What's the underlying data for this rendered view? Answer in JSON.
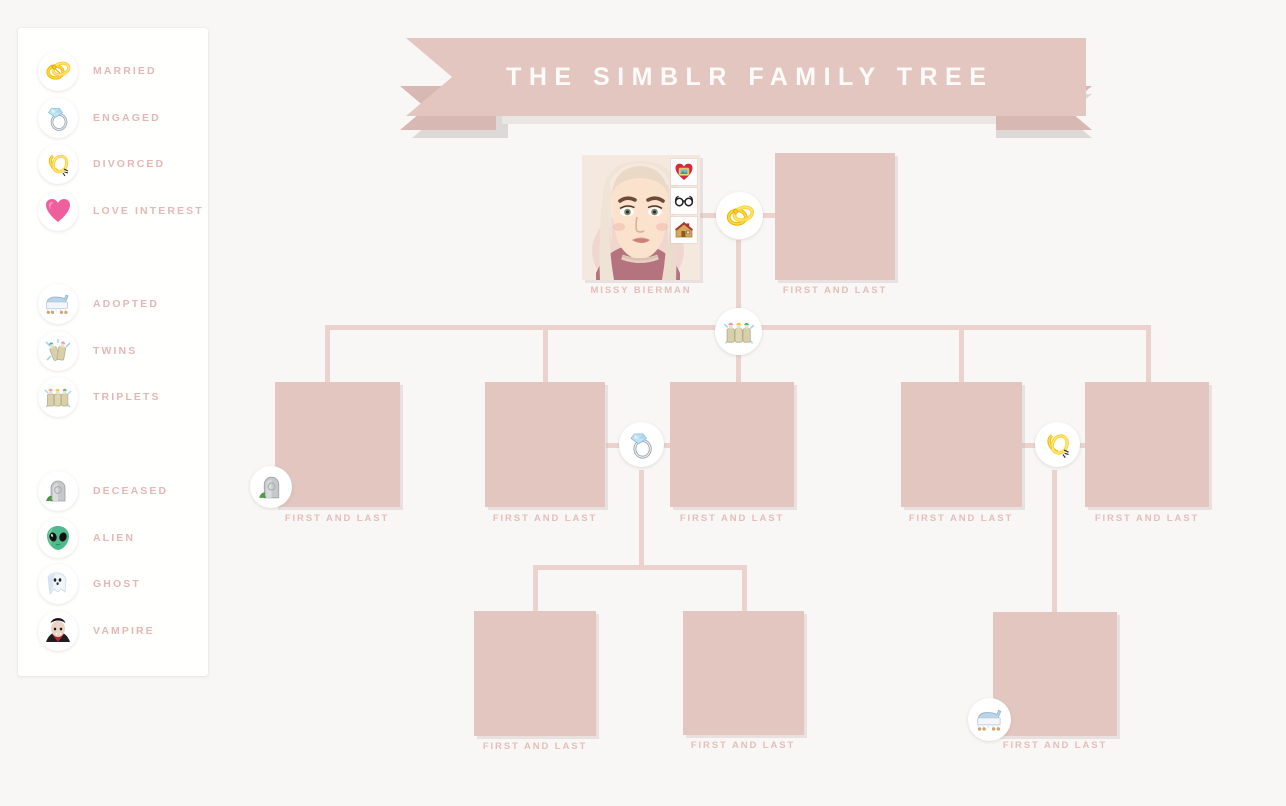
{
  "banner": {
    "title": "THE SIMBLR FAMILY TREE"
  },
  "legend": {
    "groups": [
      {
        "items": [
          {
            "label": "MARRIED",
            "icon": "wedding-rings-icon"
          },
          {
            "label": "ENGAGED",
            "icon": "engagement-ring-icon"
          },
          {
            "label": "DIVORCED",
            "icon": "broken-rings-icon"
          },
          {
            "label": "LOVE INTEREST",
            "icon": "heart-icon"
          }
        ]
      },
      {
        "items": [
          {
            "label": "ADOPTED",
            "icon": "cradle-icon"
          },
          {
            "label": "TWINS",
            "icon": "two-bottles-icon"
          },
          {
            "label": "TRIPLETS",
            "icon": "three-bottles-icon"
          }
        ]
      },
      {
        "items": [
          {
            "label": "DECEASED",
            "icon": "tombstone-icon"
          },
          {
            "label": "ALIEN",
            "icon": "alien-icon"
          },
          {
            "label": "GHOST",
            "icon": "ghost-icon"
          },
          {
            "label": "VAMPIRE",
            "icon": "vampire-icon"
          }
        ]
      }
    ]
  },
  "tree": {
    "generation1": [
      {
        "id": "missy",
        "name": "MISSY BIERMAN",
        "type": "portrait",
        "traits": [
          "family-heart-icon",
          "glasses-icon",
          "house-icon"
        ]
      },
      {
        "id": "spouse1",
        "name": "FIRST AND LAST",
        "type": "placeholder"
      }
    ],
    "generation2": [
      {
        "id": "g2a",
        "name": "FIRST AND LAST",
        "badge": "tombstone-icon"
      },
      {
        "id": "g2b",
        "name": "FIRST AND LAST",
        "badge": null
      },
      {
        "id": "g2c",
        "name": "FIRST AND LAST",
        "badge": null
      },
      {
        "id": "g2d",
        "name": "FIRST AND LAST",
        "badge": null
      },
      {
        "id": "g2e",
        "name": "FIRST AND LAST",
        "badge": null
      }
    ],
    "generation3": [
      {
        "id": "g3a",
        "name": "FIRST AND LAST",
        "badge": null
      },
      {
        "id": "g3b",
        "name": "FIRST AND LAST",
        "badge": null
      },
      {
        "id": "g3c",
        "name": "FIRST AND LAST",
        "badge": "cradle-icon"
      }
    ],
    "relationships": [
      {
        "from": "missy",
        "to": "spouse1",
        "status": "MARRIED",
        "icon": "wedding-rings-icon"
      },
      {
        "from": "g2b",
        "to": "g2c",
        "status": "ENGAGED",
        "icon": "engagement-ring-icon"
      },
      {
        "from": "g2d",
        "to": "g2e",
        "status": "DIVORCED",
        "icon": "broken-rings-icon"
      },
      {
        "from": "missy",
        "to": "children",
        "status": "TRIPLETS",
        "icon": "three-bottles-icon"
      }
    ]
  },
  "colors": {
    "background": "#f8f7f5",
    "card": "#e3c6c0",
    "line": "#ecd2cd",
    "label": "#e6bdb8",
    "banner": "#e3c6c0",
    "banner_text": "#fdfbfa"
  }
}
